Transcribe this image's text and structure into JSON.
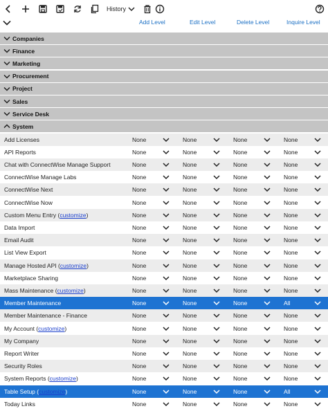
{
  "toolbar": {
    "history_label": "History",
    "icons": [
      "back-icon",
      "add-icon",
      "save-icon",
      "save-and-close-icon",
      "refresh-icon",
      "copy-icon",
      "history-chevron-icon",
      "delete-icon",
      "info-icon",
      "help-icon"
    ]
  },
  "headers": {
    "add_level": "Add Level",
    "edit_level": "Edit Level",
    "delete_level": "Delete Level",
    "inquire_level": "Inquire Level"
  },
  "sections": [
    {
      "label": "Companies",
      "expanded": false
    },
    {
      "label": "Finance",
      "expanded": false
    },
    {
      "label": "Marketing",
      "expanded": false
    },
    {
      "label": "Procurement",
      "expanded": false
    },
    {
      "label": "Project",
      "expanded": false
    },
    {
      "label": "Sales",
      "expanded": false
    },
    {
      "label": "Service Desk",
      "expanded": false
    },
    {
      "label": "System",
      "expanded": true
    }
  ],
  "customize_link": "customize",
  "system_items": [
    {
      "label": "Add Licenses",
      "customize": false,
      "add": "None",
      "edit": "None",
      "delete": "None",
      "inquire": "None",
      "selected": false
    },
    {
      "label": "API Reports",
      "customize": false,
      "add": "None",
      "edit": "None",
      "delete": "None",
      "inquire": "None",
      "selected": false
    },
    {
      "label": "Chat with ConnectWise Manage Support",
      "customize": false,
      "add": "None",
      "edit": "None",
      "delete": "None",
      "inquire": "None",
      "selected": false
    },
    {
      "label": "ConnectWise Manage Labs",
      "customize": false,
      "add": "None",
      "edit": "None",
      "delete": "None",
      "inquire": "None",
      "selected": false
    },
    {
      "label": "ConnectWise Next",
      "customize": false,
      "add": "None",
      "edit": "None",
      "delete": "None",
      "inquire": "None",
      "selected": false
    },
    {
      "label": "ConnectWise Now",
      "customize": false,
      "add": "None",
      "edit": "None",
      "delete": "None",
      "inquire": "None",
      "selected": false
    },
    {
      "label": "Custom Menu Entry",
      "customize": true,
      "add": "None",
      "edit": "None",
      "delete": "None",
      "inquire": "None",
      "selected": false
    },
    {
      "label": "Data Import",
      "customize": false,
      "add": "None",
      "edit": "None",
      "delete": "None",
      "inquire": "None",
      "selected": false
    },
    {
      "label": "Email Audit",
      "customize": false,
      "add": "None",
      "edit": "None",
      "delete": "None",
      "inquire": "None",
      "selected": false
    },
    {
      "label": "List View Export",
      "customize": false,
      "add": "None",
      "edit": "None",
      "delete": "None",
      "inquire": "None",
      "selected": false
    },
    {
      "label": "Manage Hosted API",
      "customize": true,
      "add": "None",
      "edit": "None",
      "delete": "None",
      "inquire": "None",
      "selected": false
    },
    {
      "label": "Marketplace Sharing",
      "customize": false,
      "add": "None",
      "edit": "None",
      "delete": "None",
      "inquire": "None",
      "selected": false
    },
    {
      "label": "Mass Maintenance",
      "customize": true,
      "add": "None",
      "edit": "None",
      "delete": "None",
      "inquire": "None",
      "selected": false
    },
    {
      "label": "Member Maintenance",
      "customize": false,
      "add": "None",
      "edit": "None",
      "delete": "None",
      "inquire": "All",
      "selected": true
    },
    {
      "label": "Member Maintenance - Finance",
      "customize": false,
      "add": "None",
      "edit": "None",
      "delete": "None",
      "inquire": "None",
      "selected": false
    },
    {
      "label": "My Account",
      "customize": true,
      "add": "None",
      "edit": "None",
      "delete": "None",
      "inquire": "None",
      "selected": false
    },
    {
      "label": "My Company",
      "customize": false,
      "add": "None",
      "edit": "None",
      "delete": "None",
      "inquire": "None",
      "selected": false
    },
    {
      "label": "Report Writer",
      "customize": false,
      "add": "None",
      "edit": "None",
      "delete": "None",
      "inquire": "None",
      "selected": false
    },
    {
      "label": "Security Roles",
      "customize": false,
      "add": "None",
      "edit": "None",
      "delete": "None",
      "inquire": "None",
      "selected": false
    },
    {
      "label": "System Reports",
      "customize": true,
      "add": "None",
      "edit": "None",
      "delete": "None",
      "inquire": "None",
      "selected": false
    },
    {
      "label": "Table Setup",
      "customize": true,
      "add": "None",
      "edit": "None",
      "delete": "None",
      "inquire": "All",
      "selected": true
    },
    {
      "label": "Today Links",
      "customize": false,
      "add": "None",
      "edit": "None",
      "delete": "None",
      "inquire": "None",
      "selected": false
    }
  ],
  "colors": {
    "section_bg": "#c4c4c4",
    "selected_bg": "#1e73d2",
    "alt_row_bg": "#ececec",
    "header_link": "#1a6fc4"
  }
}
